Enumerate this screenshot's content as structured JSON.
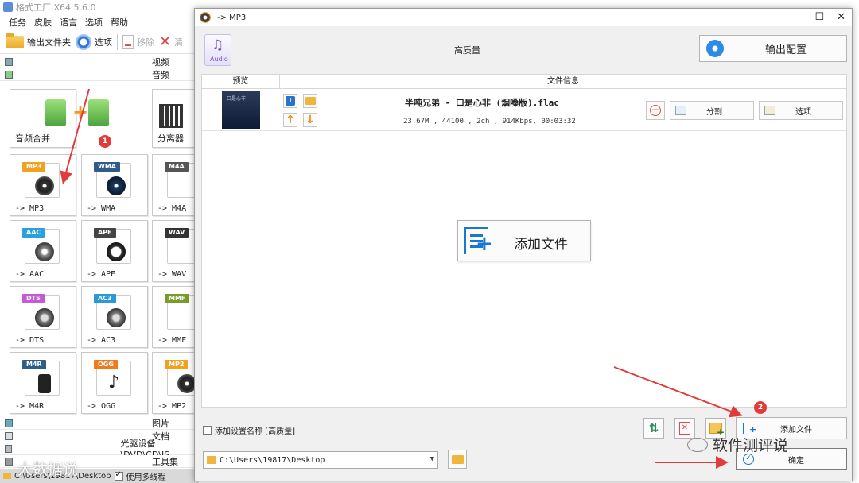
{
  "main": {
    "title": "格式工厂 X64 5.6.0",
    "menu": [
      "任务",
      "皮肤",
      "语言",
      "选项",
      "帮助"
    ],
    "toolbar": {
      "output_folder": "输出文件夹",
      "options": "选项",
      "remove": "移除",
      "clear": "清"
    },
    "categories_top": {
      "video": "视频",
      "audio": "音频"
    },
    "tiles": {
      "merge": "音频合并",
      "splitter": "分离器",
      "mp3": "-> MP3",
      "wma": "-> WMA",
      "m4a": "-> M4A",
      "aac": "-> AAC",
      "ape": "-> APE",
      "wav": "-> WAV",
      "dts": "-> DTS",
      "ac3": "-> AC3",
      "mmf": "-> MMF",
      "m4r": "-> M4R",
      "ogg": "-> OGG",
      "mp2": "-> MP2"
    },
    "badges": {
      "mp3": "MP3",
      "wma": "WMA",
      "m4a": "M4A",
      "aac": "AAC",
      "ape": "APE",
      "wav": "WAV",
      "dts": "DTS",
      "ac3": "AC3",
      "mmf": "MMF",
      "m4r": "M4R",
      "ogg": "OGG",
      "mp2": "MP2"
    },
    "categories_bottom": {
      "image": "图片",
      "document": "文档",
      "disc": "光驱设备\\DVD\\CD\\IS",
      "tools": "工具集"
    },
    "status": {
      "path": "C:\\Users\\19817\\Desktop",
      "multithread": "使用多线程"
    }
  },
  "dialog": {
    "title": "-> MP3",
    "quality": "高质量",
    "audio_icon_text": "Audio",
    "output_config": "输出配置",
    "headers": {
      "preview": "预览",
      "file_info": "文件信息"
    },
    "file": {
      "name": "半吨兄弟 - 口是心非 (烟嗓版).flac",
      "meta": "23.67M , 44100 , 2ch , 914Kbps, 00:03:32",
      "cover_text": "口是心非"
    },
    "row_buttons": {
      "split": "分割",
      "options": "选项"
    },
    "add_file_big": "添加文件",
    "checkbox_label": "添加设置名称 [高质量]",
    "add_file": "添加文件",
    "output_path": "C:\\Users\\19817\\Desktop",
    "ok": "确定"
  },
  "annotations": {
    "marker_1": "1",
    "marker_2": "2"
  },
  "watermarks": {
    "right": "软件测评说",
    "left": "大数据说"
  },
  "colors": {
    "accent_blue": "#1976d2",
    "marker_red": "#e23b3b",
    "folder_yellow": "#f0b63b"
  }
}
